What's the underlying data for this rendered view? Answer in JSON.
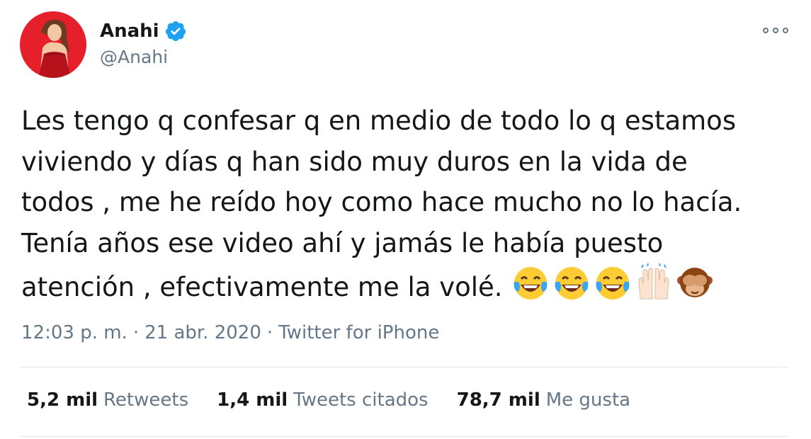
{
  "author": {
    "display_name": "Anahi",
    "handle": "@Anahi",
    "verified": true,
    "avatar_icon": "profile-photo",
    "verified_icon": "verified-badge-icon"
  },
  "more_icon": "more-options-icon",
  "tweet": {
    "text": "Les tengo q confesar q en medio de todo lo q estamos\nviviendo y días q han sido muy duros en la vida de\ntodos , me he reído hoy como hace mucho no lo hacía.\nTenía años ese video ahí y jamás le había puesto\natención , efectivamente me la volé.",
    "emojis": [
      "laughing-crying-face-icon",
      "laughing-crying-face-icon",
      "laughing-crying-face-icon",
      "raised-hands-icon",
      "see-no-evil-monkey-icon"
    ]
  },
  "meta": {
    "time": "12:03 p. m.",
    "date": "21 abr. 2020",
    "separator": "·",
    "source": "Twitter for iPhone"
  },
  "stats": {
    "retweets": {
      "value": "5,2 mil",
      "label": "Retweets"
    },
    "quotes": {
      "value": "1,4 mil",
      "label": "Tweets citados"
    },
    "likes": {
      "value": "78,7 mil",
      "label": "Me gusta"
    }
  },
  "colors": {
    "primary_text": "#14171a",
    "secondary_text": "#657786",
    "verified_blue": "#1da1f2",
    "divider": "#e1e8ed",
    "avatar_background": "#e5202a"
  }
}
